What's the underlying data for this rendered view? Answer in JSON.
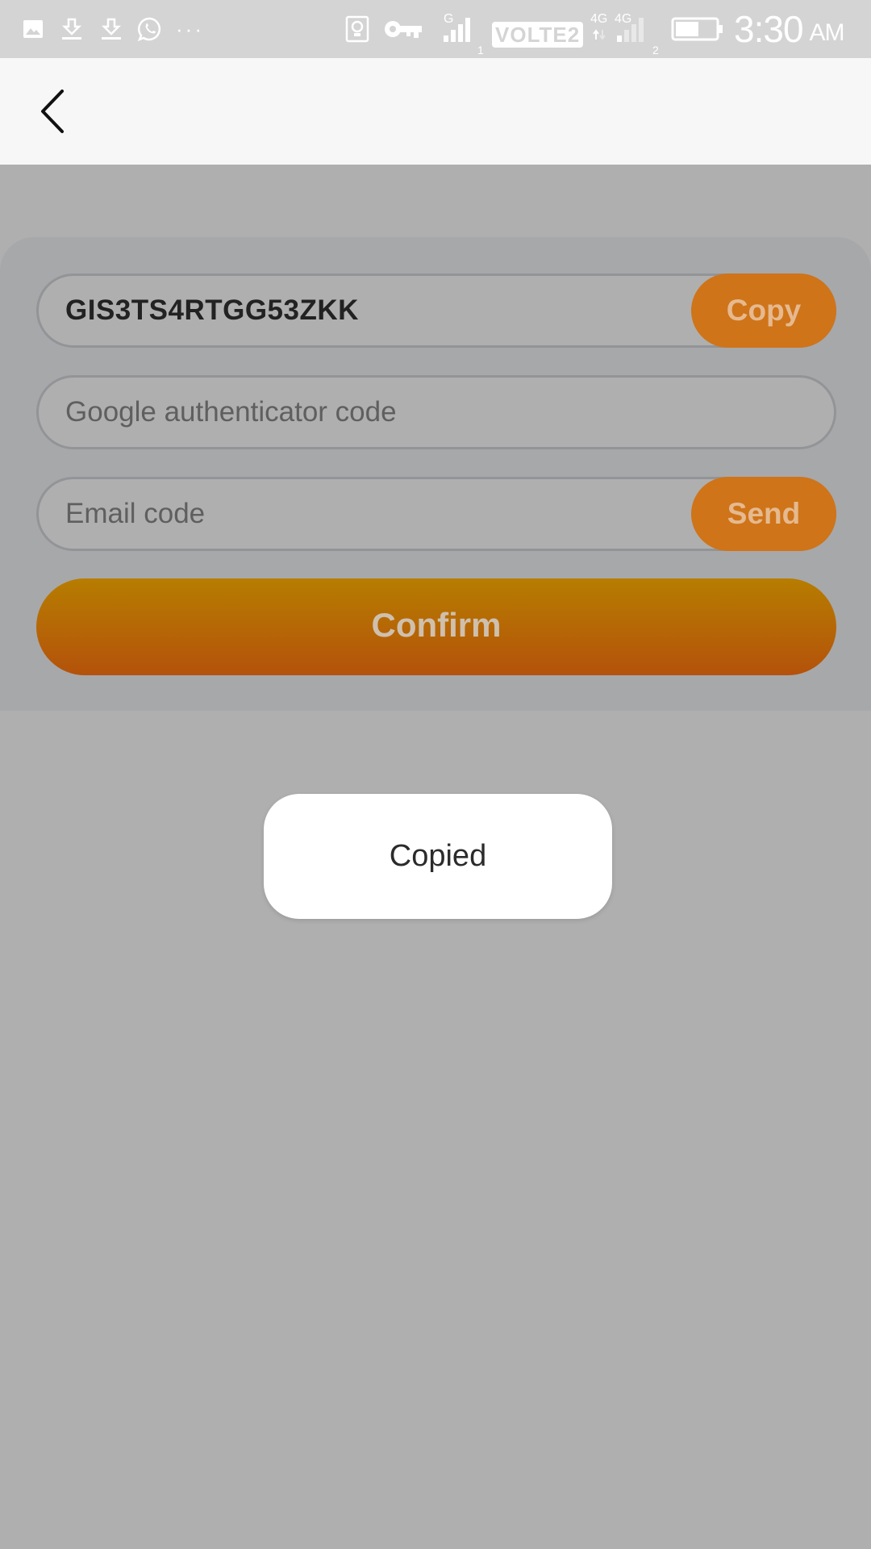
{
  "status_bar": {
    "icons": [
      "image-icon",
      "download-icon",
      "download-icon",
      "whatsapp-icon",
      "more-icon",
      "alarm-icon",
      "vpn-key-icon",
      "signal-icon",
      "volte-badge",
      "signal-icon",
      "battery-icon"
    ],
    "more_dots": "···",
    "signal_type_1": "G",
    "sim1_label": "1",
    "volte_label": "VOLTE2",
    "network_4g_a": "4G",
    "network_4g_b": "4G",
    "sim2_label": "2",
    "time": "3:30",
    "ampm": "AM"
  },
  "header": {
    "back_icon": "chevron-left-icon"
  },
  "form": {
    "secret_key": "GIS3TS4RTGG53ZKK",
    "copy_label": "Copy",
    "google_code_placeholder": "Google authenticator code",
    "email_code_placeholder": "Email code",
    "send_label": "Send",
    "confirm_label": "Confirm"
  },
  "toast": {
    "message": "Copied"
  },
  "colors": {
    "accent": "#cf7419",
    "confirm_gradient_top": "#b77d00",
    "confirm_gradient_bottom": "#b4520b",
    "overlay_bg": "#afafaf",
    "status_bar_bg": "#d4d4d4",
    "app_bar_bg": "#f7f7f7"
  }
}
